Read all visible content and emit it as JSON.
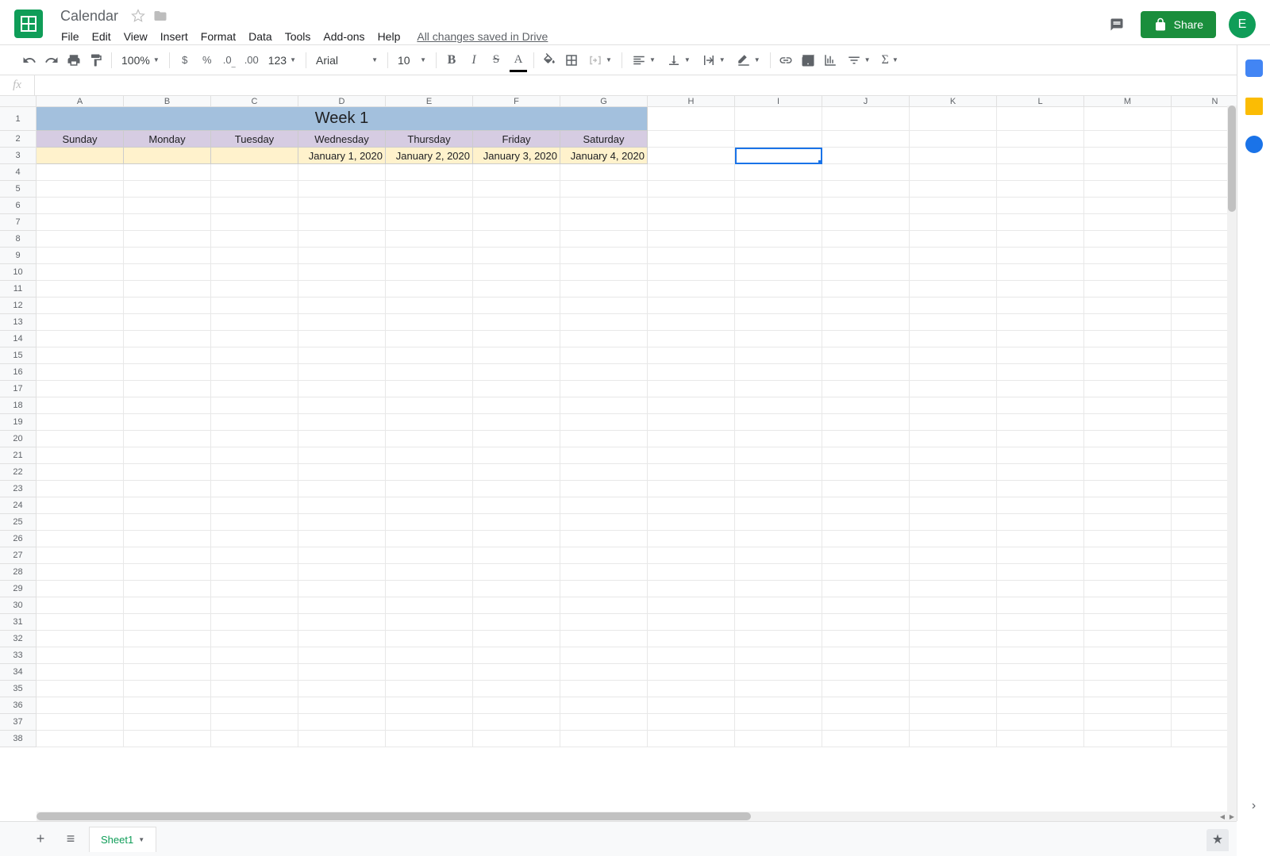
{
  "doc": {
    "title": "Calendar",
    "save_status": "All changes saved in Drive"
  },
  "menu": [
    "File",
    "Edit",
    "View",
    "Insert",
    "Format",
    "Data",
    "Tools",
    "Add-ons",
    "Help"
  ],
  "toolbar": {
    "zoom": "100%",
    "format123": "123",
    "font": "Arial",
    "font_size": "10"
  },
  "share": {
    "label": "Share"
  },
  "avatar": {
    "initial": "E"
  },
  "columns": [
    "A",
    "B",
    "C",
    "D",
    "E",
    "F",
    "G",
    "H",
    "I",
    "J",
    "K",
    "L",
    "M",
    "N"
  ],
  "row_count": 38,
  "sheet": {
    "week_title": "Week 1",
    "days": [
      "Sunday",
      "Monday",
      "Tuesday",
      "Wednesday",
      "Thursday",
      "Friday",
      "Saturday"
    ],
    "dates": [
      "",
      "",
      "",
      "January 1, 2020",
      "January 2, 2020",
      "January 3, 2020",
      "January 4, 2020"
    ]
  },
  "active_cell": "I3",
  "tabs": {
    "sheet1": "Sheet1"
  },
  "fx": {
    "label": "fx"
  }
}
